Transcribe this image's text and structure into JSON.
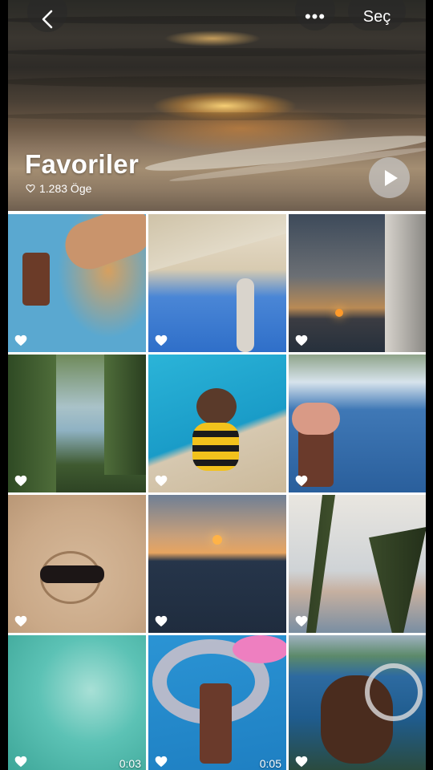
{
  "album": {
    "title": "Favoriler",
    "item_count": "1.283 Öge"
  },
  "toolbar": {
    "back_icon": "chevron-left-icon",
    "more_label": "•••",
    "select_label": "Seç"
  },
  "colors": {
    "button_bg": "#3a3a3a",
    "play_bg": "#c8c8c8",
    "text": "#ffffff"
  },
  "grid": {
    "tiles": [
      {
        "kind": "photo",
        "favorite": true,
        "duration": ""
      },
      {
        "kind": "photo",
        "favorite": true,
        "duration": ""
      },
      {
        "kind": "photo",
        "favorite": true,
        "duration": ""
      },
      {
        "kind": "photo",
        "favorite": true,
        "duration": ""
      },
      {
        "kind": "photo",
        "favorite": true,
        "duration": ""
      },
      {
        "kind": "photo",
        "favorite": true,
        "duration": ""
      },
      {
        "kind": "photo",
        "favorite": true,
        "duration": ""
      },
      {
        "kind": "photo",
        "favorite": true,
        "duration": ""
      },
      {
        "kind": "photo",
        "favorite": true,
        "duration": ""
      },
      {
        "kind": "video",
        "favorite": true,
        "duration": "0:03"
      },
      {
        "kind": "video",
        "favorite": true,
        "duration": "0:05"
      },
      {
        "kind": "photo",
        "favorite": true,
        "duration": ""
      }
    ]
  }
}
